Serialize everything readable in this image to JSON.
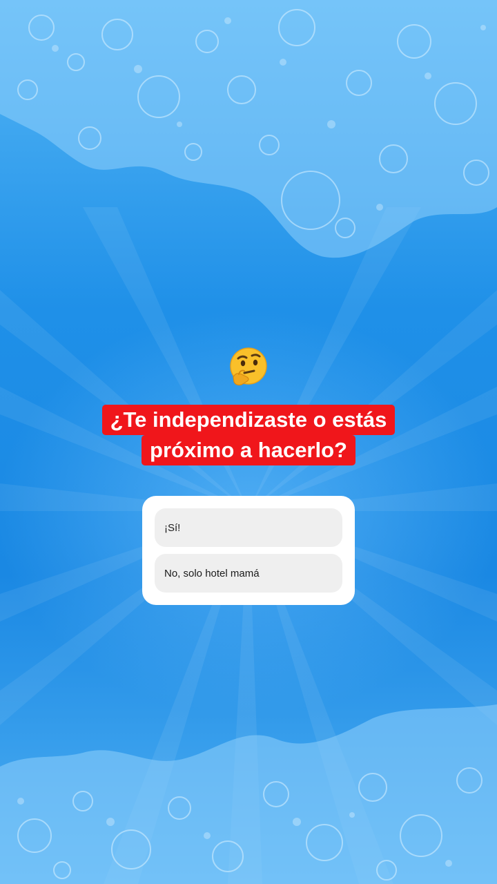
{
  "story": {
    "emoji": "thinking-face",
    "question_line_1": "¿Te independizaste o estás",
    "question_line_2": "próximo a hacerlo?",
    "colors": {
      "background": "#1e8fe6",
      "question_highlight": "#f0161b",
      "poll_card": "#ffffff",
      "option_fill": "#efefef"
    }
  },
  "poll": {
    "options": [
      {
        "label": "¡Sí!"
      },
      {
        "label": "No, solo hotel mamá"
      }
    ]
  }
}
